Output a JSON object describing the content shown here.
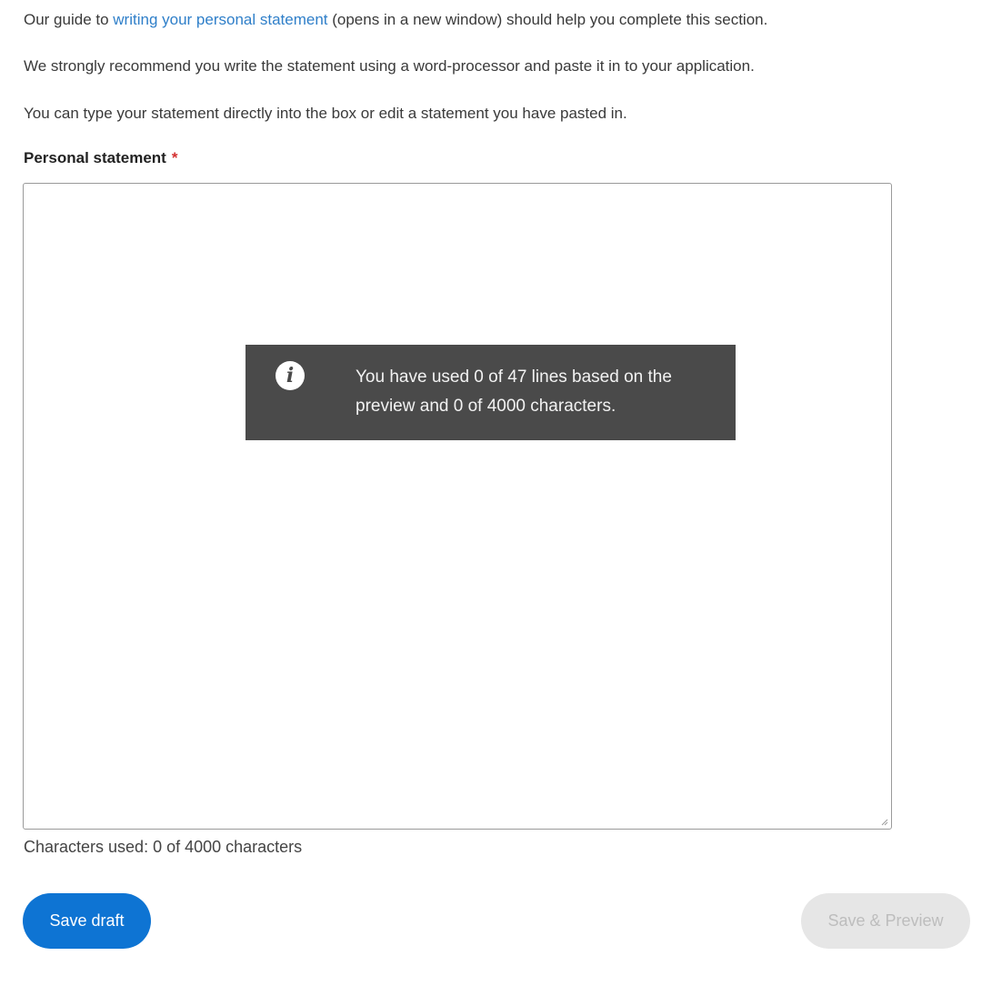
{
  "intro": {
    "line1_prefix": "Our guide to ",
    "line1_link": "writing your personal statement",
    "line1_suffix": " (opens in a new window) should help you complete this section.",
    "line2": "We strongly recommend you write the statement using a word-processor and paste it in to your application.",
    "line3": "You can type your statement directly into the box or edit a statement you have pasted in."
  },
  "field": {
    "label": "Personal statement",
    "required_marker": "*",
    "value": "",
    "placeholder": ""
  },
  "tooltip": {
    "icon": "info-icon",
    "text": "You have used 0 of 47 lines based on the preview and 0 of 4000 characters."
  },
  "counter": {
    "text": "Characters used: 0 of 4000 characters"
  },
  "actions": {
    "save_draft_label": "Save draft",
    "save_preview_label": "Save & Preview"
  },
  "colors": {
    "link": "#2f7fc9",
    "primary_button": "#0e74d3",
    "disabled_button": "#e6e6e6",
    "tooltip_bg": "#4a4a4a",
    "required": "#d32f2f"
  }
}
